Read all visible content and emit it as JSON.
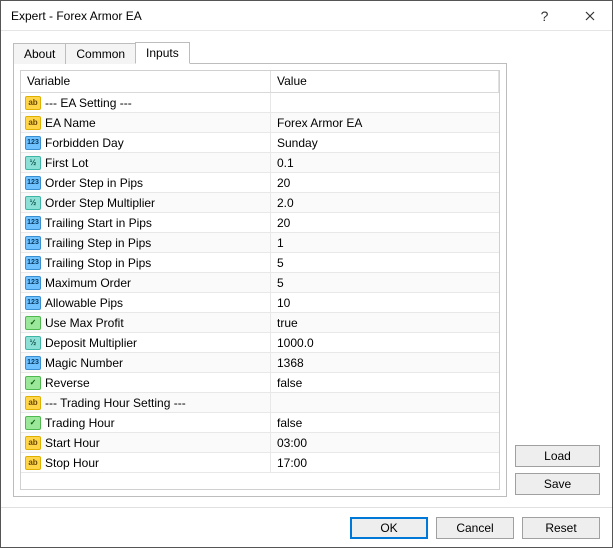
{
  "window": {
    "title": "Expert - Forex Armor EA"
  },
  "tabs": {
    "about": "About",
    "common": "Common",
    "inputs": "Inputs"
  },
  "grid": {
    "header_variable": "Variable",
    "header_value": "Value",
    "rows": [
      {
        "icon": "ab",
        "variable": "--- EA Setting ---",
        "value": ""
      },
      {
        "icon": "ab",
        "variable": "EA Name",
        "value": "Forex Armor EA"
      },
      {
        "icon": "123",
        "variable": "Forbidden Day",
        "value": "Sunday"
      },
      {
        "icon": "va",
        "variable": "First Lot",
        "value": "0.1"
      },
      {
        "icon": "123",
        "variable": "Order Step in Pips",
        "value": "20"
      },
      {
        "icon": "va",
        "variable": "Order Step Multiplier",
        "value": "2.0"
      },
      {
        "icon": "123",
        "variable": "Trailing Start in Pips",
        "value": "20"
      },
      {
        "icon": "123",
        "variable": "Trailing Step in Pips",
        "value": "1"
      },
      {
        "icon": "123",
        "variable": "Trailing Stop in Pips",
        "value": "5"
      },
      {
        "icon": "123",
        "variable": "Maximum Order",
        "value": "5"
      },
      {
        "icon": "123",
        "variable": "Allowable Pips",
        "value": "10"
      },
      {
        "icon": "bool",
        "variable": "Use Max Profit",
        "value": "true"
      },
      {
        "icon": "va",
        "variable": "Deposit Multiplier",
        "value": "1000.0"
      },
      {
        "icon": "123",
        "variable": "Magic Number",
        "value": "1368"
      },
      {
        "icon": "bool",
        "variable": "Reverse",
        "value": "false"
      },
      {
        "icon": "ab",
        "variable": "--- Trading Hour Setting ---",
        "value": ""
      },
      {
        "icon": "bool",
        "variable": "Trading Hour",
        "value": "false"
      },
      {
        "icon": "ab",
        "variable": "Start Hour",
        "value": "03:00"
      },
      {
        "icon": "ab",
        "variable": "Stop Hour",
        "value": "17:00"
      }
    ]
  },
  "buttons": {
    "load": "Load",
    "save": "Save",
    "ok": "OK",
    "cancel": "Cancel",
    "reset": "Reset"
  }
}
